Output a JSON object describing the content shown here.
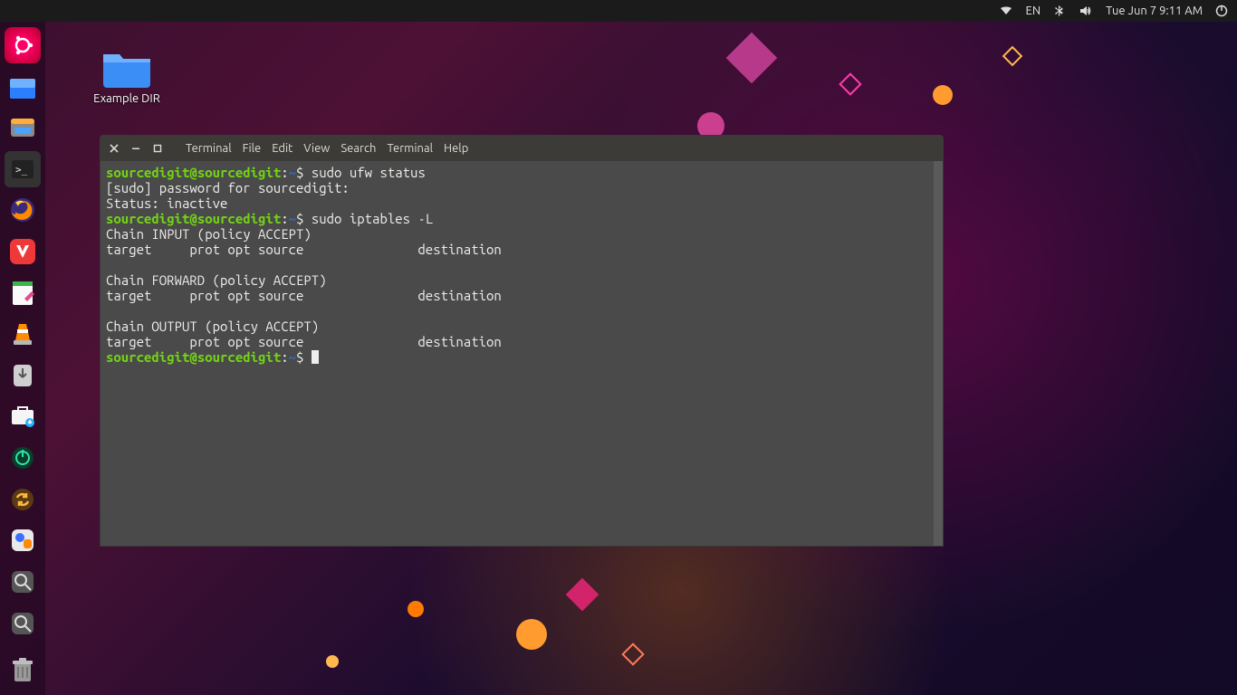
{
  "topbar": {
    "lang": "EN",
    "datetime": "Tue Jun  7  9:11 AM"
  },
  "desktop": {
    "folder1": {
      "label": "Example DIR"
    }
  },
  "terminal": {
    "menus": [
      "Terminal",
      "File",
      "Edit",
      "View",
      "Search",
      "Terminal",
      "Help"
    ],
    "prompt": {
      "user": "sourcedigit",
      "at": "@",
      "host": "sourcedigit",
      "colon": ":",
      "path": "~",
      "sigil": "$"
    },
    "lines": [
      {
        "type": "cmd",
        "cmd": "sudo ufw status"
      },
      {
        "type": "out",
        "text": "[sudo] password for sourcedigit: "
      },
      {
        "type": "out",
        "text": "Status: inactive"
      },
      {
        "type": "cmd",
        "cmd": "sudo iptables -L"
      },
      {
        "type": "out",
        "text": "Chain INPUT (policy ACCEPT)"
      },
      {
        "type": "out",
        "text": "target     prot opt source               destination         "
      },
      {
        "type": "out",
        "text": ""
      },
      {
        "type": "out",
        "text": "Chain FORWARD (policy ACCEPT)"
      },
      {
        "type": "out",
        "text": "target     prot opt source               destination         "
      },
      {
        "type": "out",
        "text": ""
      },
      {
        "type": "out",
        "text": "Chain OUTPUT (policy ACCEPT)"
      },
      {
        "type": "out",
        "text": "target     prot opt source               destination         "
      },
      {
        "type": "cmd-cursor",
        "cmd": ""
      }
    ]
  },
  "dock": {
    "items": [
      "ubuntu",
      "files",
      "file-manager",
      "terminal",
      "firefox",
      "vivaldi",
      "text-editor",
      "vlc",
      "downloads",
      "software-center",
      "settings-power",
      "sync",
      "app-switch",
      "search1",
      "search2"
    ]
  }
}
